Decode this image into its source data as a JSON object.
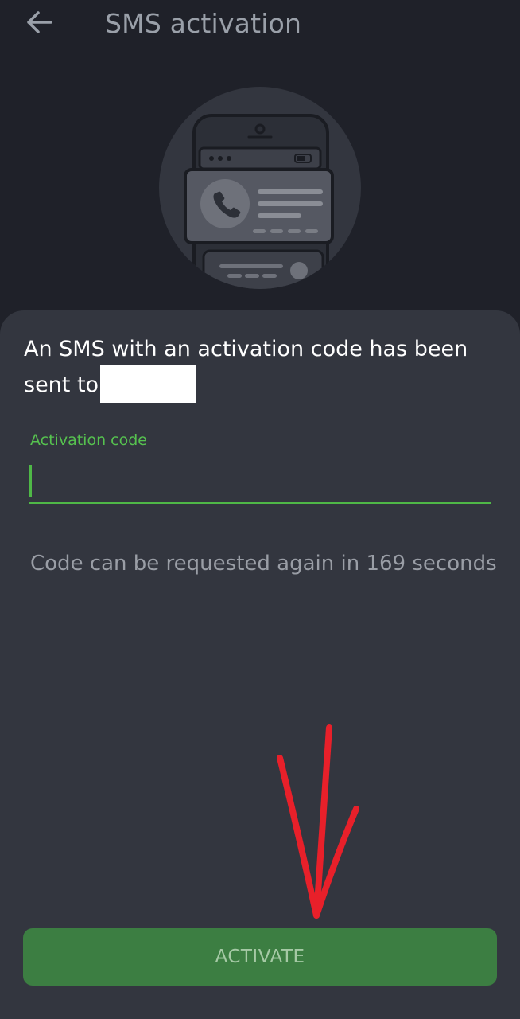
{
  "header": {
    "title": "SMS activation",
    "back_icon": "arrow-left-icon"
  },
  "illustration": {
    "icon": "phone-contact-card-illustration"
  },
  "sheet": {
    "sent_message": "An SMS with an activation code has been sent to",
    "activation_field": {
      "label": "Activation code",
      "value": ""
    },
    "resend_notice": "Code can be requested again in 169 seconds",
    "activate_button": "ACTIVATE"
  },
  "colors": {
    "background": "#1f2129",
    "sheet": "#33363f",
    "accent_green": "#4fb847",
    "button_green": "#3c7e42",
    "annotation_red": "#e8202a"
  }
}
